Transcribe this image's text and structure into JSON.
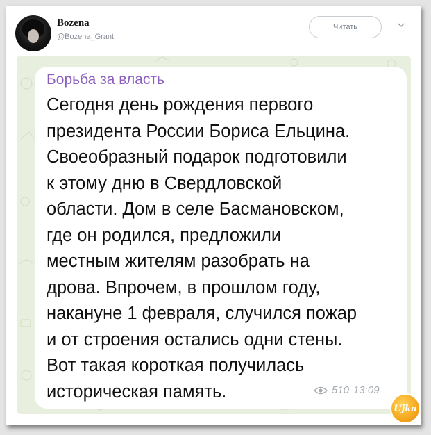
{
  "tweet": {
    "author_name": "Bozena",
    "author_handle": "@Bozena_Grant",
    "follow_button_label": "Читать"
  },
  "message": {
    "channel_name": "Борьба за власть",
    "lines": [
      "Сегодня день рождения первого",
      "президента России Бориса Ельцина.",
      "Своеобразный подарок подготовили",
      "к этому дню в Свердловской",
      "области. Дом в селе Басмановском,",
      "где он родился, предложили",
      "местным жителям разобрать на",
      "дрова. Впрочем, в прошлом году,",
      "накануне 1 февраля, случился пожар",
      "и от строения остались одни стены.",
      "Вот такая короткая получилась",
      "историческая память."
    ],
    "views": "510",
    "time": "13:09"
  },
  "watermark": {
    "text": "Ujka",
    "color": "#f5a71d"
  },
  "colors": {
    "channel_name": "#8c5fbf",
    "chat_background": "#e9efdf",
    "meta_text": "#a6abb0"
  },
  "icons": {
    "chevron": "chevron-down-icon",
    "views": "eye-icon"
  }
}
